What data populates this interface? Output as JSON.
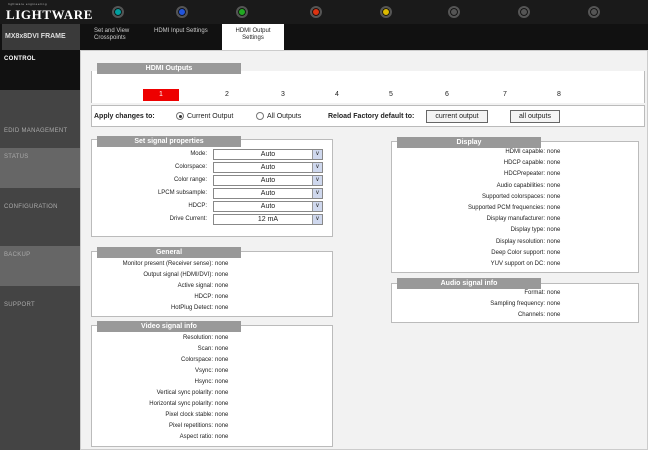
{
  "logo": {
    "tagline": "lightware engineering",
    "brand": "LIGHTWARE"
  },
  "leds": [
    "#00a0a0",
    "#2255dd",
    "#22aa22",
    "#dd3311",
    "#ddbb00",
    "#555555",
    "#555555",
    "#555555"
  ],
  "frame_name": "MX8x8DVI FRAME",
  "tabs": [
    {
      "label": "Set and View Crosspoints",
      "active": false
    },
    {
      "label": "HDMI Input Settings",
      "active": false
    },
    {
      "label": "HDMI Output Settings",
      "active": true
    }
  ],
  "sidebar": {
    "items": [
      {
        "label": "CONTROL"
      },
      {
        "label": "EDID MANAGEMENT"
      },
      {
        "label": "STATUS"
      },
      {
        "label": "CONFIGURATION"
      },
      {
        "label": "BACKUP"
      },
      {
        "label": "SUPPORT"
      }
    ]
  },
  "outputs": {
    "title": "HDMI Outputs",
    "ports": [
      "1",
      "2",
      "3",
      "4",
      "5",
      "6",
      "7",
      "8"
    ],
    "selected_index": 0
  },
  "apply": {
    "label": "Apply changes to:",
    "current_output": "Current Output",
    "all_outputs": "All Outputs",
    "reload_label": "Reload Factory default to:",
    "btn_current": "current output",
    "btn_all": "all outputs"
  },
  "signal": {
    "title": "Set signal properties",
    "rows": [
      {
        "label": "Mode:",
        "value": "Auto"
      },
      {
        "label": "Colorspace:",
        "value": "Auto"
      },
      {
        "label": "Color range:",
        "value": "Auto"
      },
      {
        "label": "LPCM subsample:",
        "value": "Auto"
      },
      {
        "label": "HDCP:",
        "value": "Auto"
      },
      {
        "label": "Drive Current:",
        "value": "12 mA"
      }
    ]
  },
  "general": {
    "title": "General",
    "rows": [
      {
        "label": "Monitor present (Receiver sense):",
        "value": "none"
      },
      {
        "label": "Output signal (HDMI/DVI):",
        "value": "none"
      },
      {
        "label": "Active signal:",
        "value": "none"
      },
      {
        "label": "HDCP:",
        "value": "none"
      },
      {
        "label": "HotPlug Detect:",
        "value": "none"
      }
    ]
  },
  "video": {
    "title": "Video signal info",
    "rows": [
      {
        "label": "Resolution:",
        "value": "none"
      },
      {
        "label": "Scan:",
        "value": "none"
      },
      {
        "label": "Colorspace:",
        "value": "none"
      },
      {
        "label": "Vsync:",
        "value": "none"
      },
      {
        "label": "Hsync:",
        "value": "none"
      },
      {
        "label": "Vertical sync polarity:",
        "value": "none"
      },
      {
        "label": "Horizontal sync polarity:",
        "value": "none"
      },
      {
        "label": "Pixel clock stable:",
        "value": "none"
      },
      {
        "label": "Pixel repetitions:",
        "value": "none"
      },
      {
        "label": "Aspect ratio:",
        "value": "none"
      }
    ]
  },
  "display": {
    "title": "Display",
    "rows": [
      {
        "label": "HDMI capable:",
        "value": "none"
      },
      {
        "label": "HDCP capable:",
        "value": "none"
      },
      {
        "label": "HDCPrepeater:",
        "value": "none"
      },
      {
        "label": "Audio capabilities:",
        "value": "none"
      },
      {
        "label": "Supported colorspaces:",
        "value": "none"
      },
      {
        "label": "Supported PCM frequencies:",
        "value": "none"
      },
      {
        "label": "Display manufacturer:",
        "value": "none"
      },
      {
        "label": "Display type:",
        "value": "none"
      },
      {
        "label": "Display resolution:",
        "value": "none"
      },
      {
        "label": "Deep Color support:",
        "value": "none"
      },
      {
        "label": "YUV support on DC:",
        "value": "none"
      }
    ]
  },
  "audio": {
    "title": "Audio signal info",
    "rows": [
      {
        "label": "Format:",
        "value": "none"
      },
      {
        "label": "Sampling frequency:",
        "value": "none"
      },
      {
        "label": "Channels:",
        "value": "none"
      }
    ]
  }
}
